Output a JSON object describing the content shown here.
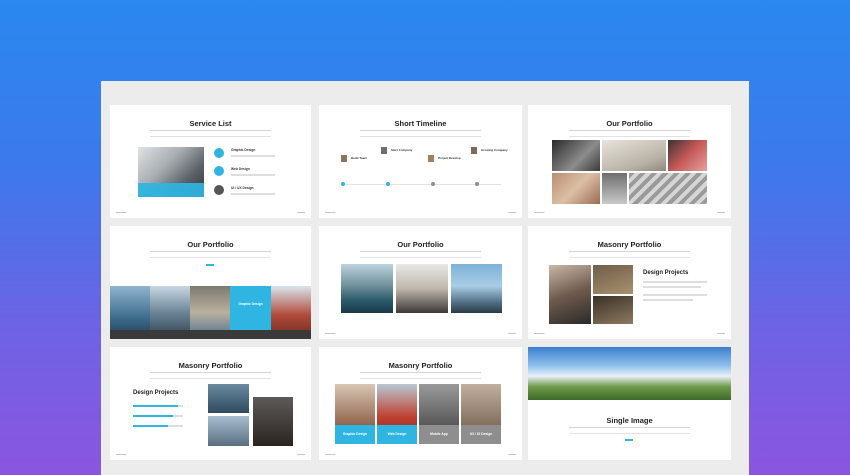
{
  "colors": {
    "accent": "#2eb5e2",
    "dark": "#3a3a3a",
    "gray": "#8e8e8e"
  },
  "slides": {
    "service_list": {
      "title": "Service List",
      "services": [
        "Graphic Design",
        "Web Design",
        "UI / UX Design"
      ],
      "icons": [
        "display-icon",
        "monitor-icon",
        "mobile-icon"
      ]
    },
    "short_timeline": {
      "title": "Short Timeline",
      "milestones": [
        "Start Company",
        "Build Team",
        "Project Develop",
        "Growing Company"
      ]
    },
    "our_portfolio_grid": {
      "title": "Our Portfolio"
    },
    "our_portfolio_strip": {
      "title": "Our Portfolio",
      "feature_label": "Graphic Design"
    },
    "our_portfolio_three": {
      "title": "Our Portfolio"
    },
    "masonry_portfolio_a": {
      "title": "Masonry Portfolio",
      "heading": "Design Projects"
    },
    "masonry_portfolio_b": {
      "title": "Masonry Portfolio",
      "heading": "Design Projects"
    },
    "masonry_portfolio_c": {
      "title": "Masonry Portfolio",
      "captions": [
        "Graphic Design",
        "Web Design",
        "Mobile App",
        "UX / UI Design"
      ]
    },
    "single_image": {
      "title": "Single Image"
    }
  }
}
